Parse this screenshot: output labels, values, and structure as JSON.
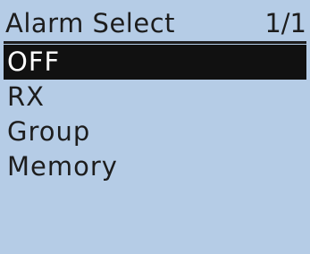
{
  "header": {
    "title": "Alarm Select",
    "page": "1/1"
  },
  "menu": {
    "items": [
      {
        "label": "OFF",
        "selected": true
      },
      {
        "label": "RX",
        "selected": false
      },
      {
        "label": "Group",
        "selected": false
      },
      {
        "label": "Memory",
        "selected": false
      }
    ]
  },
  "colors": {
    "background": "#b5cce6",
    "text": "#1d1d1d",
    "highlight_background": "#111111",
    "highlight_text": "#ffffff"
  }
}
